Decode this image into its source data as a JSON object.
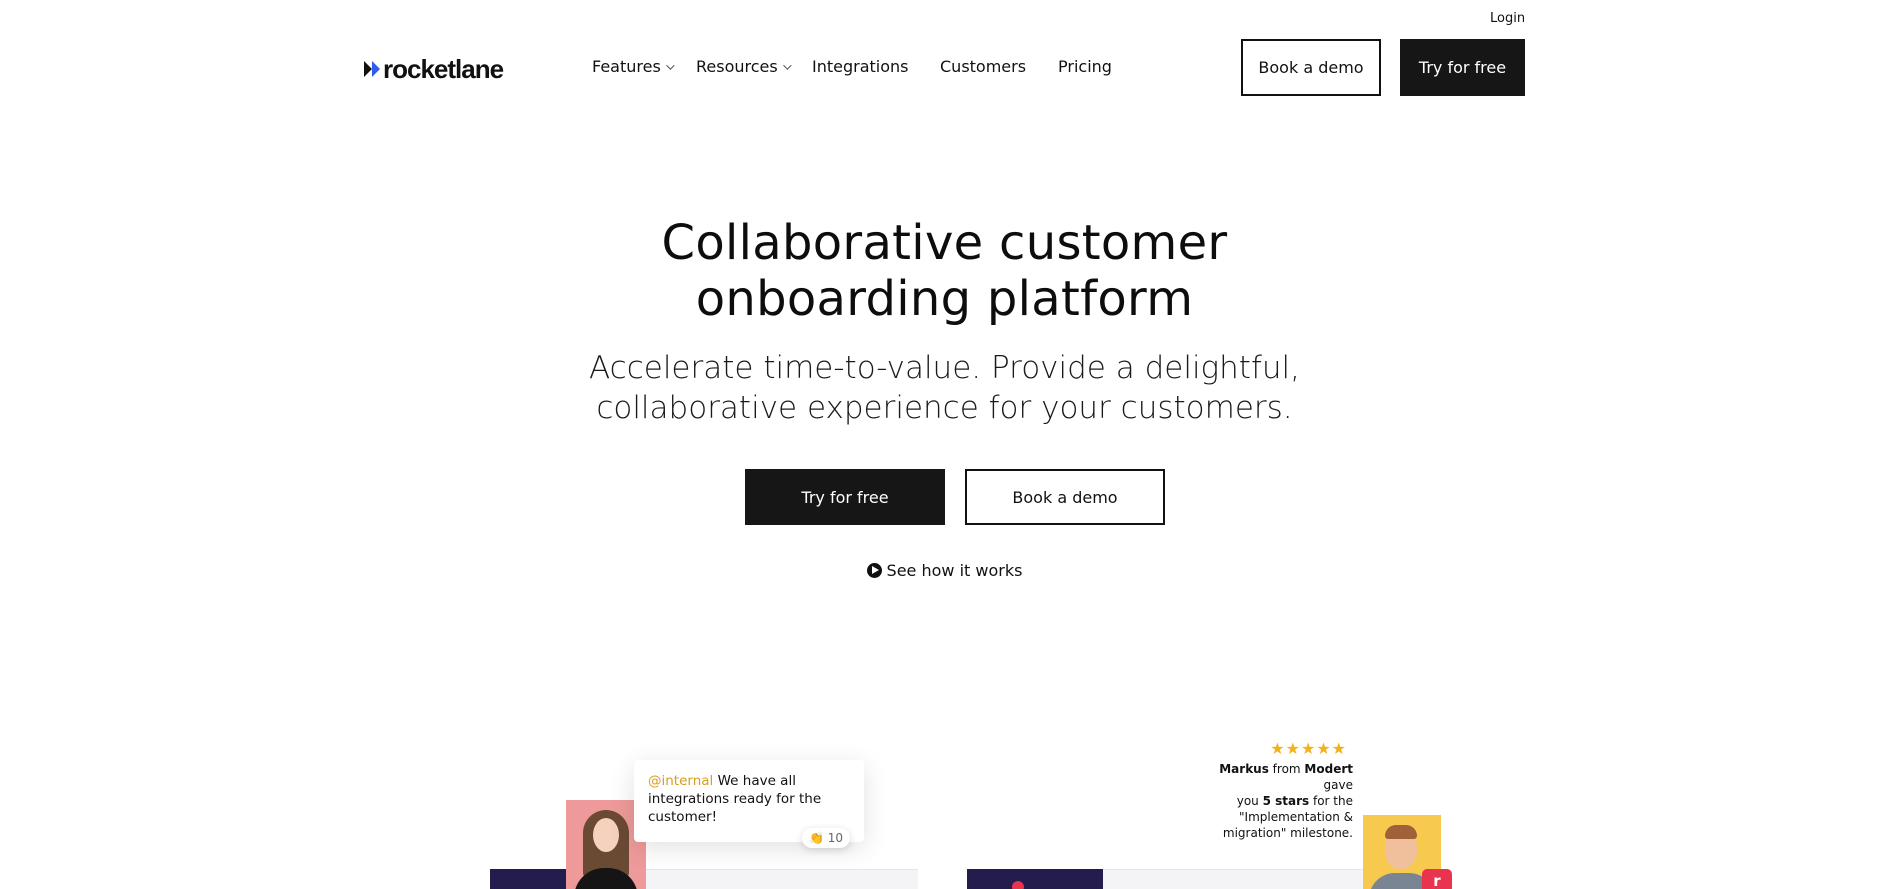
{
  "header": {
    "login_label": "Login",
    "logo_text": "rocketlane",
    "nav": [
      {
        "label": "Features",
        "has_dropdown": true
      },
      {
        "label": "Resources",
        "has_dropdown": true
      },
      {
        "label": "Integrations",
        "has_dropdown": false
      },
      {
        "label": "Customers",
        "has_dropdown": false
      },
      {
        "label": "Pricing",
        "has_dropdown": false
      }
    ],
    "book_demo_label": "Book a demo",
    "try_free_label": "Try for free"
  },
  "hero": {
    "title_line1": "Collaborative customer",
    "title_line2": "onboarding platform",
    "subtitle_line1": "Accelerate time-to-value. Provide a delightful,",
    "subtitle_line2": "collaborative experience for your customers.",
    "try_free_label": "Try for free",
    "book_demo_label": "Book a demo",
    "see_how_label": "See how it works"
  },
  "illustrations": {
    "chat": {
      "mention": "@internal",
      "message_part1": " We have all",
      "message_part2": "integrations ready for the",
      "message_part3": "customer!",
      "reaction": "👏 10"
    },
    "rating": {
      "stars": "★★★★★",
      "name": "Markus",
      "from_text": " from ",
      "company": "Modert",
      "gave_text": " gave",
      "you_text": "you ",
      "stars_text": "5 stars",
      "for_text": " for the",
      "milestone_line1": "\"Implementation &",
      "milestone_line2": "migration\" milestone."
    },
    "badge_letter": "r"
  },
  "colors": {
    "accent_blue": "#2f5bf0",
    "dark_button": "#161616",
    "mention_gold": "#d89d22",
    "star_yellow": "#f2b21b",
    "brand_red": "#e8344e"
  }
}
